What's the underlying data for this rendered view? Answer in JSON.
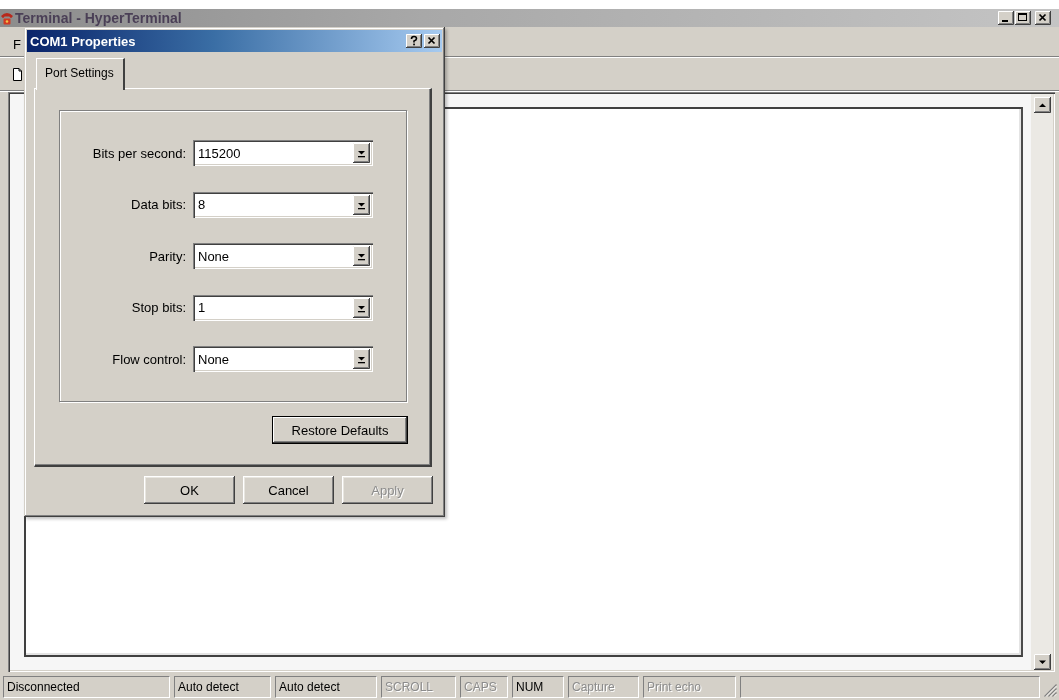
{
  "main_window": {
    "title": "Terminal - HyperTerminal",
    "menu_bar": [
      "F"
    ],
    "status_bar": [
      {
        "text": "Disconnected",
        "disabled": false
      },
      {
        "text": "Auto detect",
        "disabled": false
      },
      {
        "text": "Auto detect",
        "disabled": false
      },
      {
        "text": "SCROLL",
        "disabled": true
      },
      {
        "text": "CAPS",
        "disabled": true
      },
      {
        "text": "NUM",
        "disabled": false
      },
      {
        "text": "Capture",
        "disabled": true
      },
      {
        "text": "Print echo",
        "disabled": true
      }
    ]
  },
  "dialog": {
    "title": "COM1 Properties",
    "tabs": [
      {
        "label": "Port Settings",
        "selected": true
      }
    ],
    "settings": [
      {
        "label": "Bits per second:",
        "value": "115200"
      },
      {
        "label": "Data bits:",
        "value": "8"
      },
      {
        "label": "Parity:",
        "value": "None"
      },
      {
        "label": "Stop bits:",
        "value": "1"
      },
      {
        "label": "Flow control:",
        "value": "None"
      }
    ],
    "restore_button": {
      "label": "Restore Defaults",
      "default": true
    },
    "buttons": [
      {
        "label": "OK",
        "disabled": false
      },
      {
        "label": "Cancel",
        "disabled": false
      },
      {
        "label": "Apply",
        "disabled": true
      }
    ]
  }
}
